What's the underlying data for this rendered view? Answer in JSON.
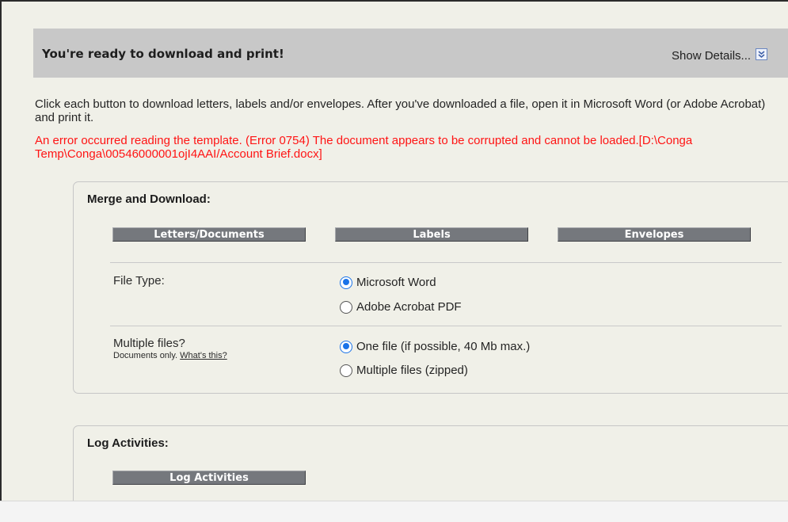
{
  "header": {
    "title": "You're ready to download and print!",
    "show_details_label": "Show Details..."
  },
  "intro_text": "Click each button to download letters, labels and/or envelopes. After you've downloaded a file, open it in Microsoft Word (or Adobe Acrobat) and print it.",
  "error_text": "An error occurred reading the template. (Error 0754) The document appears to be corrupted and cannot be loaded.[D:\\Conga Temp\\Conga\\00546000001ojI4AAI/Account Brief.docx]",
  "merge": {
    "title": "Merge and Download:",
    "buttons": {
      "letters": "Letters/Documents",
      "labels": "Labels",
      "envelopes": "Envelopes"
    },
    "file_type": {
      "label": "File Type:",
      "options": [
        {
          "label": "Microsoft Word",
          "checked": true
        },
        {
          "label": "Adobe Acrobat PDF",
          "checked": false
        }
      ]
    },
    "multiple_files": {
      "label": "Multiple files?",
      "sublabel": "Documents only.",
      "help_link": "What's this?",
      "options": [
        {
          "label": "One file (if possible, 40 Mb max.)",
          "checked": true
        },
        {
          "label": "Multiple files (zipped)",
          "checked": false
        }
      ]
    }
  },
  "log": {
    "title": "Log Activities:",
    "button": "Log Activities"
  },
  "colors": {
    "error": "#ff1414",
    "button_bg": "#75787d",
    "radio_accent": "#1a73e8",
    "header_bg": "#c8c8c8"
  }
}
